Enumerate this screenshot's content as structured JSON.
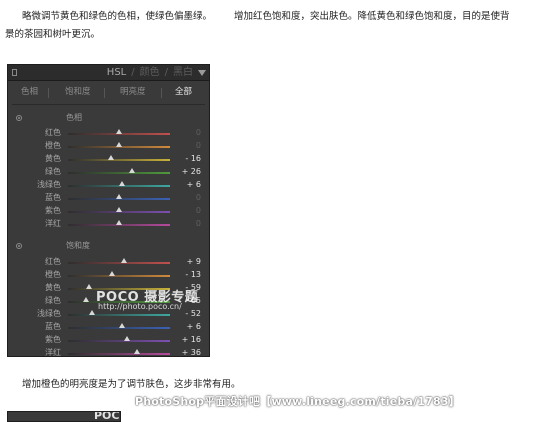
{
  "paragraph_1": {
    "left_text": "略微调节黄色和绿色的色相，使绿色偏墨绿。",
    "right_text": "增加红色饱和度，突出肤色。降低黄色和绿色饱和度，目的是使背",
    "line_2": "景的茶园和树叶更沉。"
  },
  "paragraph_2": "增加橙色的明亮度是为了调节肤色，这步非常有用。",
  "panel": {
    "header": {
      "tabs": [
        "HSL",
        "颜色",
        "黑白"
      ],
      "separator": "/",
      "active_tab": "HSL"
    },
    "subtabs": [
      "色相",
      "饱和度",
      "明亮度",
      "全部"
    ],
    "active_subtab": "全部",
    "sections": [
      {
        "title": "色相",
        "rows": [
          {
            "label": "红色",
            "value": "0",
            "level": 0,
            "color": "#c0504d"
          },
          {
            "label": "橙色",
            "value": "0",
            "level": 0,
            "color": "#d08a3c"
          },
          {
            "label": "黄色",
            "value": "- 16",
            "level": -16,
            "color": "#c9b23a"
          },
          {
            "label": "绿色",
            "value": "+ 26",
            "level": 26,
            "color": "#4e9a3c"
          },
          {
            "label": "浅绿色",
            "value": "+ 6",
            "level": 6,
            "color": "#3ea7a0"
          },
          {
            "label": "蓝色",
            "value": "0",
            "level": 0,
            "color": "#3b61b5"
          },
          {
            "label": "紫色",
            "value": "0",
            "level": 0,
            "color": "#7d4fb0"
          },
          {
            "label": "洋红",
            "value": "0",
            "level": 0,
            "color": "#b44a9c"
          }
        ]
      },
      {
        "title": "饱和度",
        "rows": [
          {
            "label": "红色",
            "value": "+ 9",
            "level": 9,
            "color": "#c0504d"
          },
          {
            "label": "橙色",
            "value": "- 13",
            "level": -13,
            "color": "#d08a3c"
          },
          {
            "label": "黄色",
            "value": "- 59",
            "level": -59,
            "color": "#c9b23a"
          },
          {
            "label": "绿色",
            "value": "- 65",
            "level": -65,
            "color": "#4e9a3c"
          },
          {
            "label": "浅绿色",
            "value": "- 52",
            "level": -52,
            "color": "#3ea7a0"
          },
          {
            "label": "蓝色",
            "value": "+ 6",
            "level": 6,
            "color": "#3b61b5"
          },
          {
            "label": "紫色",
            "value": "+ 16",
            "level": 16,
            "color": "#7d4fb0"
          },
          {
            "label": "洋红",
            "value": "+ 36",
            "level": 36,
            "color": "#b44a9c"
          }
        ]
      }
    ]
  },
  "watermark": {
    "logo": "POCO 摄影专题",
    "url": "http://photo.poco.cn/",
    "footer": "PhotoShop平面设计吧【www.lineeg.com/tieba/1783】"
  }
}
